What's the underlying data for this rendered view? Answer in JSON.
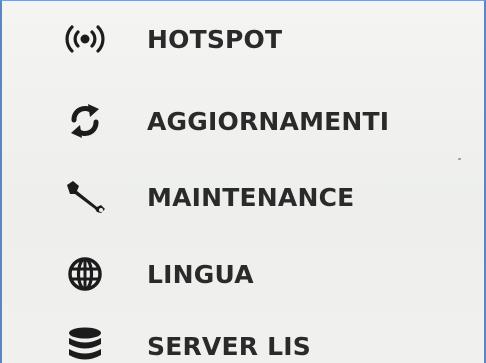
{
  "menu": {
    "items": [
      {
        "label": "HOTSPOT",
        "icon": "hotspot-icon"
      },
      {
        "label": "AGGIORNAMENTI",
        "icon": "refresh-icon"
      },
      {
        "label": "MAINTENANCE",
        "icon": "wrench-icon"
      },
      {
        "label": "LINGUA",
        "icon": "globe-icon"
      },
      {
        "label": "SERVER LIS",
        "icon": "database-icon"
      }
    ]
  },
  "colors": {
    "text": "#2a2a2a",
    "background": "#f1f2ef",
    "frame": "#5b86c4"
  }
}
